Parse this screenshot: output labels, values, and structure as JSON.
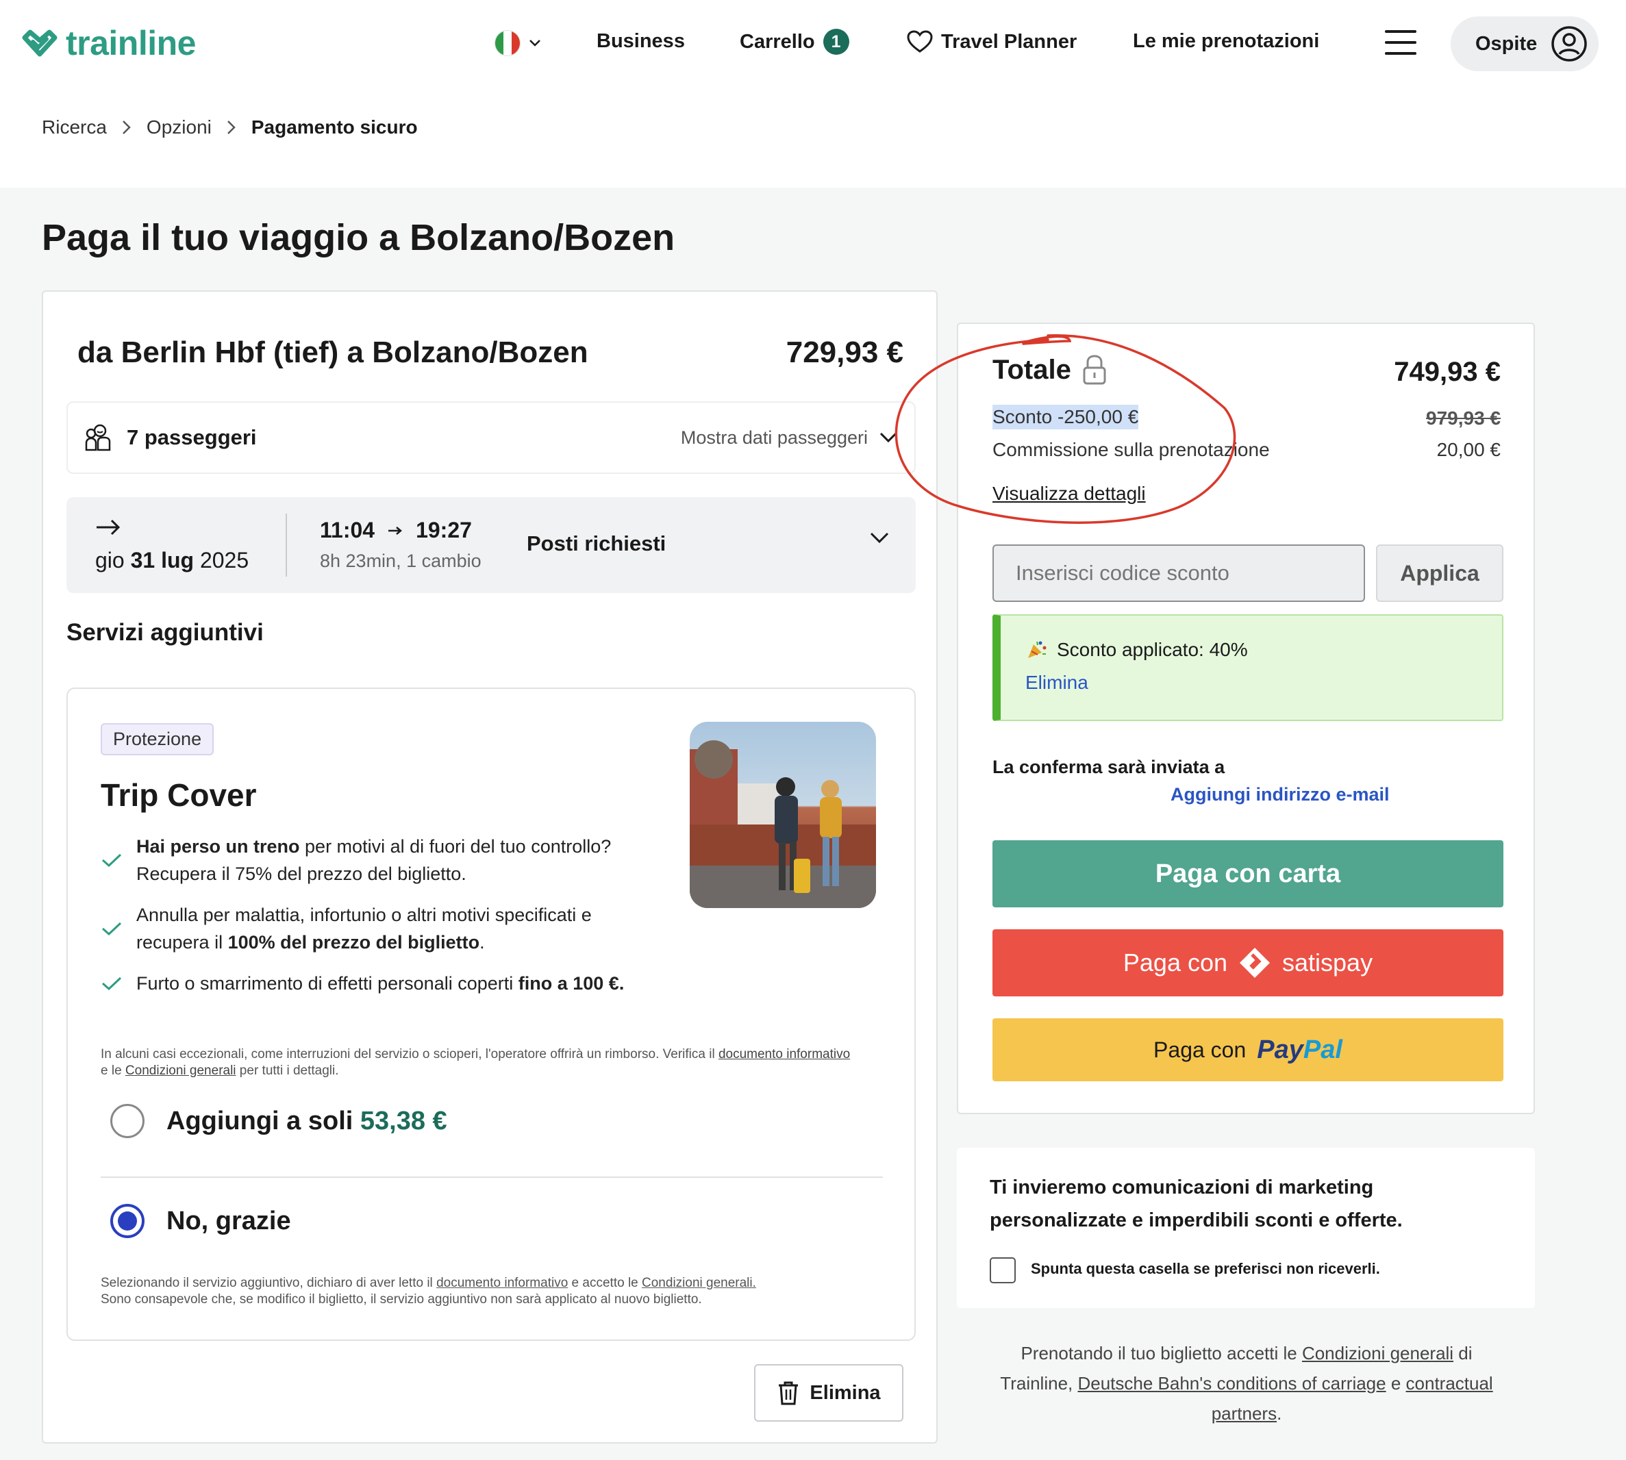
{
  "header": {
    "logo_text": "trainline",
    "nav": {
      "business": "Business",
      "cart": "Carrello",
      "cart_count": "1",
      "travel_planner": "Travel Planner",
      "bookings": "Le mie prenotazioni",
      "guest": "Ospite"
    }
  },
  "breadcrumb": [
    "Ricerca",
    "Opzioni",
    "Pagamento sicuro"
  ],
  "page_title": "Paga il tuo viaggio a Bolzano/Bozen",
  "trip": {
    "title": "da Berlin Hbf (tief) a Bolzano/Bozen",
    "price": "729,93 €",
    "passengers": "7 passeggeri",
    "show_passengers": "Mostra dati passeggeri",
    "date_prefix": "gio",
    "date_bold": "31 lug",
    "date_year": "2025",
    "departure": "11:04",
    "arrival": "19:27",
    "duration": "8h 23min, 1 cambio",
    "seats": "Posti richiesti"
  },
  "services": {
    "title": "Servizi aggiuntivi",
    "tag": "Protezione",
    "cover_title": "Trip Cover",
    "b1_bold": "Hai perso un treno",
    "b1_rest": " per motivi al di fuori del tuo controllo? Recupera il 75% del prezzo del biglietto.",
    "b2_start": "Annulla per malattia, infortunio o altri motivi specificati e recupera il ",
    "b2_bold": "100% del prezzo del biglietto",
    "b2_end": ".",
    "b3_start": "Furto o smarrimento di effetti personali coperti ",
    "b3_bold": "fino a 100 €.",
    "fine_1": "In alcuni casi eccezionali, come interruzioni del servizio o scioperi, l'operatore offrirà un rimborso. Verifica il ",
    "fine_link1": "documento informativo",
    "fine_2": " e le ",
    "fine_link2": "Condizioni generali",
    "fine_3": " per tutti i dettagli.",
    "add_label": "Aggiungi a soli ",
    "add_price": "53,38 €",
    "no_label": "No, grazie",
    "legal_1": "Selezionando il servizio aggiuntivo, dichiaro di aver letto il ",
    "legal_link1": "documento informativo",
    "legal_2": " e accetto le ",
    "legal_link2": "Condizioni generali.",
    "legal_3": "Sono consapevole che, se modifico il biglietto, il servizio aggiuntivo non sarà applicato al nuovo biglietto.",
    "delete": "Elimina"
  },
  "summary": {
    "total_label": "Totale",
    "total_value": "749,93 €",
    "discount": "Sconto -250,00 €",
    "old_price": "979,93 €",
    "fee_label": "Commissione sulla prenotazione",
    "fee_value": "20,00 €",
    "details_link": "Visualizza dettagli",
    "code_placeholder": "Inserisci codice sconto",
    "apply": "Applica",
    "applied": "Sconto applicato: 40%",
    "applied_remove": "Elimina",
    "confirm_label": "La conferma sarà inviata a",
    "add_email": "Aggiungi indirizzo e-mail",
    "pay_card": "Paga con carta",
    "pay_satispay_prefix": "Paga con",
    "pay_satispay_brand": "satispay",
    "pay_paypal_prefix": "Paga con",
    "paypal_a": "Pay",
    "paypal_b": "Pal"
  },
  "marketing": {
    "text": "Ti invieremo comunicazioni di marketing personalizzate e imperdibili sconti e offerte.",
    "checkbox_label": "Spunta questa casella se preferisci non riceverli."
  },
  "bottom_legal": {
    "t1": "Prenotando il tuo biglietto accetti le ",
    "l1": "Condizioni generali",
    "t2": " di Trainline, ",
    "l2": "Deutsche Bahn's conditions of carriage",
    "t3": " e ",
    "l3": "contractual partners",
    "t4": "."
  },
  "colors": {
    "brand": "#2d9c83",
    "pay_card": "#52a58f",
    "satispay": "#ec5145",
    "paypal": "#f6c54e",
    "link": "#2a55c4",
    "annotation": "#d9392b"
  }
}
